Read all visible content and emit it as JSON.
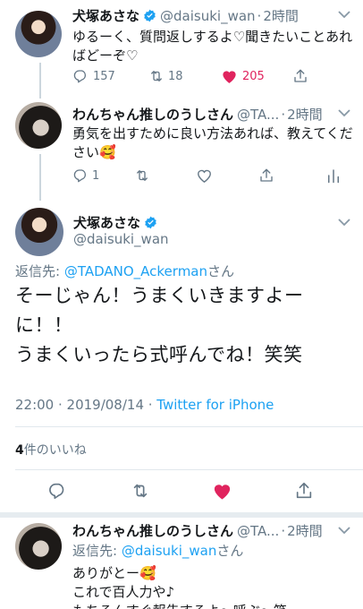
{
  "tweet1": {
    "name": "犬塚あさな",
    "handle": "@daisuki_wan",
    "dot": "·",
    "time": "2時間",
    "text": "ゆるーく、質問返しするよ♡聞きたいことあればどーぞ♡",
    "replies": "157",
    "retweets": "18",
    "likes": "205"
  },
  "tweet2": {
    "name": "わんちゃん推しのうしさん",
    "handle": "@TA...",
    "dot": "·",
    "time": "2時間",
    "text": "勇気を出すために良い方法あれば、教えてください🥰",
    "replies": "1"
  },
  "main_tweet": {
    "name": "犬塚あさな",
    "handle": "@daisuki_wan",
    "reply_to_prefix": "返信先: ",
    "reply_to_mention": "@TADANO_Ackerman",
    "reply_to_suffix": "さん",
    "text_line1": "そーじゃん！うまくいきますよー",
    "text_line2": "に！！",
    "text_line3": "うまくいったら式呼んでね！笑笑",
    "timestamp": "22:00 · 2019/08/14 · ",
    "source": "Twitter for iPhone",
    "likes_count": "4",
    "likes_label": "件のいいね"
  },
  "tweet3": {
    "name": "わんちゃん推しのうしさん",
    "handle": "@TA...",
    "dot": "·",
    "time": "2時間",
    "reply_to_prefix": "返信先: ",
    "reply_to_mention": "@daisuki_wan",
    "reply_to_suffix": "さん",
    "line1": "ありがとー🥰",
    "line2": "これで百人力や♪",
    "line3": "もちろんすぐ報告するよ〜呼ぶ〜笑"
  },
  "colors": {
    "accent": "#1da1f2",
    "like": "#e0245e",
    "muted": "#657786",
    "divider": "#e1e8ed"
  },
  "icons": [
    "verified-icon",
    "reply-icon",
    "retweet-icon",
    "like-icon",
    "share-icon",
    "analytics-icon",
    "caret-down-icon"
  ]
}
